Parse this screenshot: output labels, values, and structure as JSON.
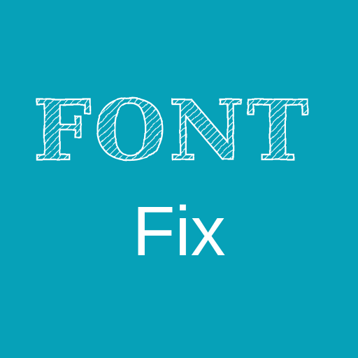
{
  "app_icon": {
    "background_color": "#06a1b8",
    "text_color": "#ffffff",
    "logo_text": "FONT",
    "subtitle": "Fix"
  }
}
